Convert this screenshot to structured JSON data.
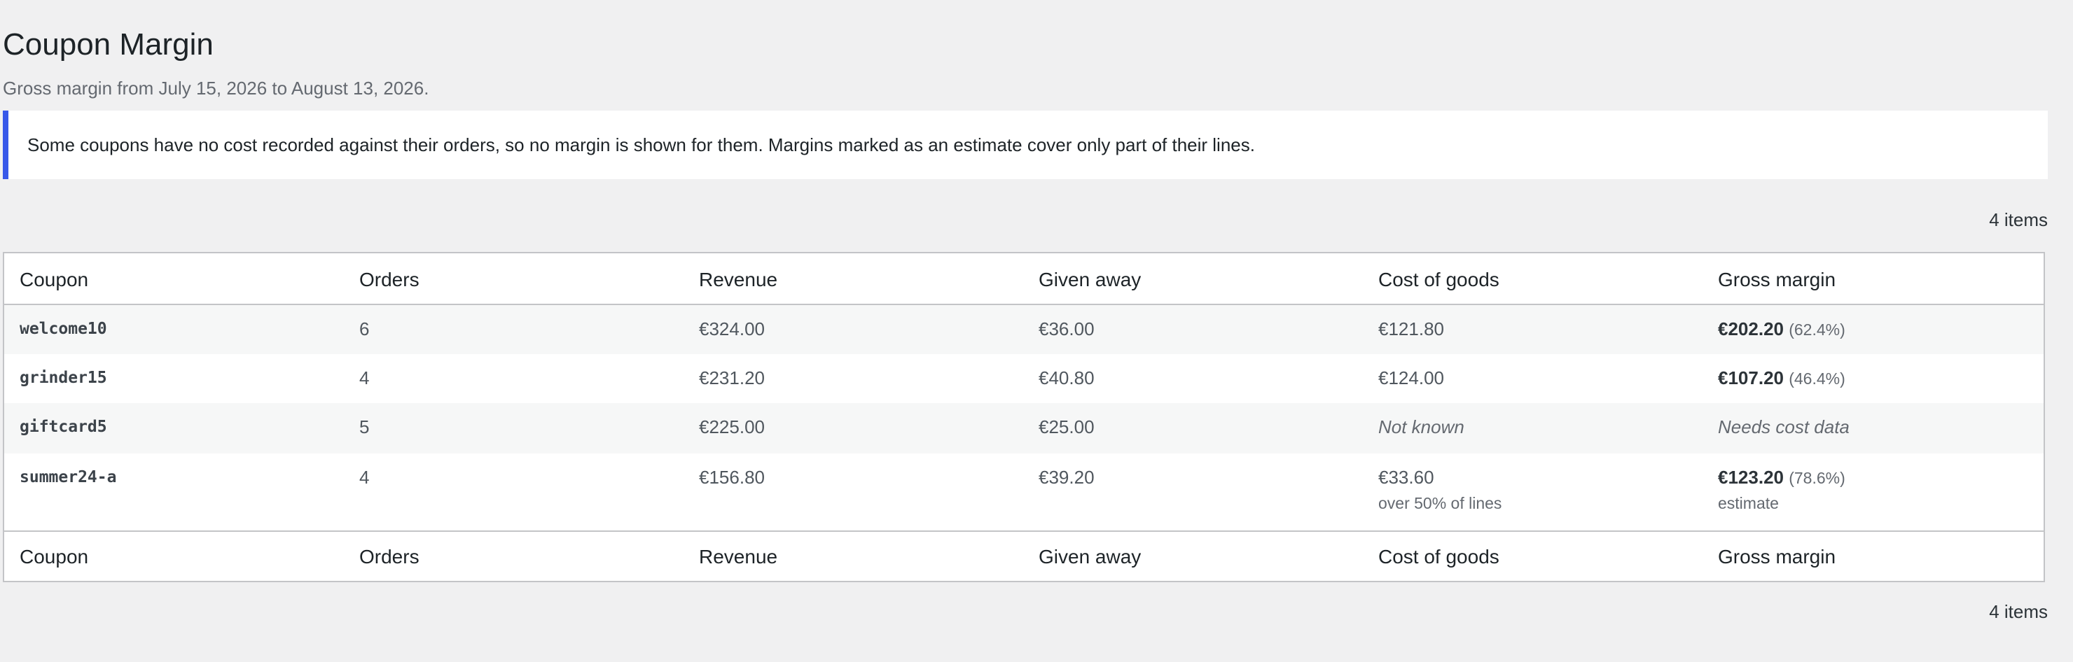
{
  "page": {
    "title": "Coupon Margin",
    "subtitle": "Gross margin from July 15, 2026 to August 13, 2026.",
    "notice": "Some coupons have no cost recorded against their orders, so no margin is shown for them. Margins marked as an estimate cover only part of their lines.",
    "item_count_top": "4 items",
    "item_count_bottom": "4 items"
  },
  "colors": {
    "notice_border": "#3858e9",
    "background": "#f0f0f1"
  },
  "table": {
    "columns": [
      "Coupon",
      "Orders",
      "Revenue",
      "Given away",
      "Cost of goods",
      "Gross margin"
    ],
    "rows": [
      {
        "coupon": "welcome10",
        "orders": "6",
        "revenue": "€324.00",
        "given_away": "€36.00",
        "cost_of_goods": "€121.80",
        "cost_note": "",
        "margin": "€202.20",
        "margin_pct": "(62.4%)",
        "margin_note": ""
      },
      {
        "coupon": "grinder15",
        "orders": "4",
        "revenue": "€231.20",
        "given_away": "€40.80",
        "cost_of_goods": "€124.00",
        "cost_note": "",
        "margin": "€107.20",
        "margin_pct": "(46.4%)",
        "margin_note": ""
      },
      {
        "coupon": "giftcard5",
        "orders": "5",
        "revenue": "€225.00",
        "given_away": "€25.00",
        "cost_of_goods": "Not known",
        "cost_note": "",
        "margin": "Needs cost data",
        "margin_pct": "",
        "margin_note": ""
      },
      {
        "coupon": "summer24-a",
        "orders": "4",
        "revenue": "€156.80",
        "given_away": "€39.20",
        "cost_of_goods": "€33.60",
        "cost_note": "over 50% of lines",
        "margin": "€123.20",
        "margin_pct": "(78.6%)",
        "margin_note": "estimate"
      }
    ]
  }
}
